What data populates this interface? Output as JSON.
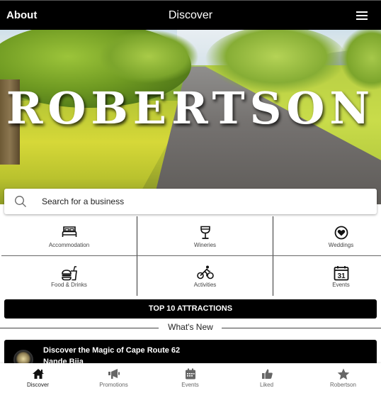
{
  "topbar": {
    "about_label": "About",
    "title": "Discover",
    "menu_icon": "hamburger-menu-icon"
  },
  "hero": {
    "town_name": "ROBERTSON",
    "image_description": "tree-lined road through vineyards"
  },
  "search": {
    "placeholder": "Search for a business",
    "icon": "search-icon"
  },
  "categories": [
    {
      "label": "Accommodation",
      "icon": "bed-icon"
    },
    {
      "label": "Wineries",
      "icon": "wine-glass-icon"
    },
    {
      "label": "Weddings",
      "icon": "heart-circle-icon"
    },
    {
      "label": "Food & Drinks",
      "icon": "burger-drink-icon"
    },
    {
      "label": "Activities",
      "icon": "cyclist-icon"
    },
    {
      "label": "Events",
      "icon": "calendar-icon",
      "calendar_day": "31"
    }
  ],
  "top10": {
    "label": "TOP 10 ATTRACTIONS"
  },
  "whats_new": {
    "heading": "What's New",
    "items": [
      {
        "title": "Discover the Magic of Cape Route 62",
        "author": "Nande Bija"
      }
    ]
  },
  "bottom_nav": {
    "active": "Discover",
    "items": [
      {
        "label": "Discover",
        "icon": "home-icon"
      },
      {
        "label": "Promotions",
        "icon": "megaphone-icon"
      },
      {
        "label": "Events",
        "icon": "calendar-icon"
      },
      {
        "label": "Liked",
        "icon": "thumbs-up-icon"
      },
      {
        "label": "Robertson",
        "icon": "star-icon"
      }
    ]
  },
  "colors": {
    "bar_background": "#000000",
    "bar_text": "#ffffff",
    "nav_icon": "#666666",
    "nav_active_icon": "#222222"
  }
}
